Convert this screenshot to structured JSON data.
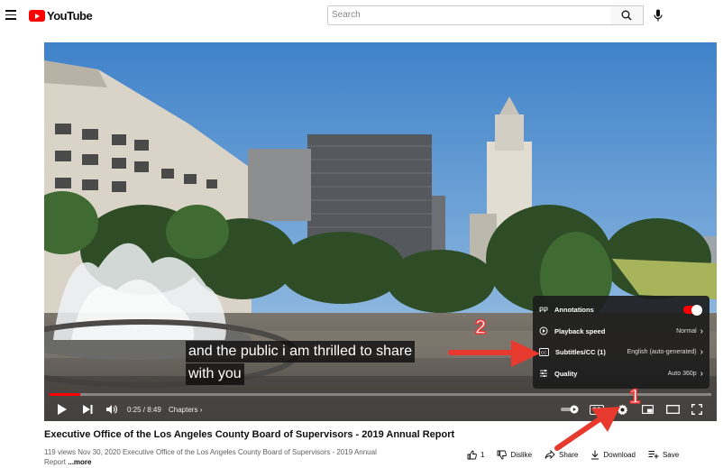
{
  "header": {
    "logo_text": "YouTube",
    "search_placeholder": "Search"
  },
  "player": {
    "caption_line1": "and the public i am thrilled to share",
    "caption_line2": "with you",
    "time": "0:25 / 8:49",
    "chapters_label": "Chapters",
    "progress": 0.047,
    "settings_menu": [
      {
        "icon": "annotations-icon",
        "label": "Annotations",
        "value": "",
        "toggle": true
      },
      {
        "icon": "playback-speed-icon",
        "label": "Playback speed",
        "value": "Normal"
      },
      {
        "icon": "subtitles-icon",
        "label": "Subtitles/CC (1)",
        "value": "English (auto-generated)"
      },
      {
        "icon": "quality-icon",
        "label": "Quality",
        "value": "Auto 360p"
      }
    ],
    "cc_badge": "CC"
  },
  "annotations": {
    "step1": "1",
    "step2": "2",
    "arrow_color": "#e8392f"
  },
  "video": {
    "title": "Executive Office of the Los Angeles County Board of Supervisors - 2019 Annual Report",
    "views": "119 views",
    "date": "Nov 30, 2020",
    "description": "Executive Office of the Los Angeles County Board of Supervisors - 2019 Annual Report",
    "more": "...more"
  },
  "actions": {
    "likes": "1",
    "dislike": "Dislike",
    "share": "Share",
    "download": "Download",
    "save": "Save"
  }
}
